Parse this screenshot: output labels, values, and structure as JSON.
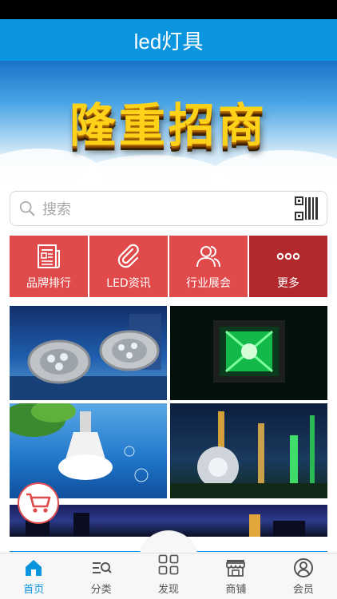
{
  "header": {
    "title": "led灯具"
  },
  "banner": {
    "text": "隆重招商"
  },
  "search": {
    "placeholder": "搜索"
  },
  "quick_nav": [
    {
      "label": "品牌排行",
      "icon": "newspaper-icon",
      "color": "#e04a4a"
    },
    {
      "label": "LED资讯",
      "icon": "paperclip-icon",
      "color": "#e04a4a"
    },
    {
      "label": "行业展会",
      "icon": "users-icon",
      "color": "#e04a4a"
    },
    {
      "label": "更多",
      "icon": "more-dots-icon",
      "color": "#b3282d"
    }
  ],
  "tabs": [
    {
      "label": "首页",
      "icon": "home-icon",
      "active": true
    },
    {
      "label": "分类",
      "icon": "category-icon",
      "active": false
    },
    {
      "label": "发现",
      "icon": "grid-icon",
      "active": false
    },
    {
      "label": "商铺",
      "icon": "store-icon",
      "active": false
    },
    {
      "label": "会员",
      "icon": "user-icon",
      "active": false
    }
  ],
  "colors": {
    "primary": "#0b95df",
    "red": "#e04a4a",
    "dark_red": "#b3282d"
  }
}
